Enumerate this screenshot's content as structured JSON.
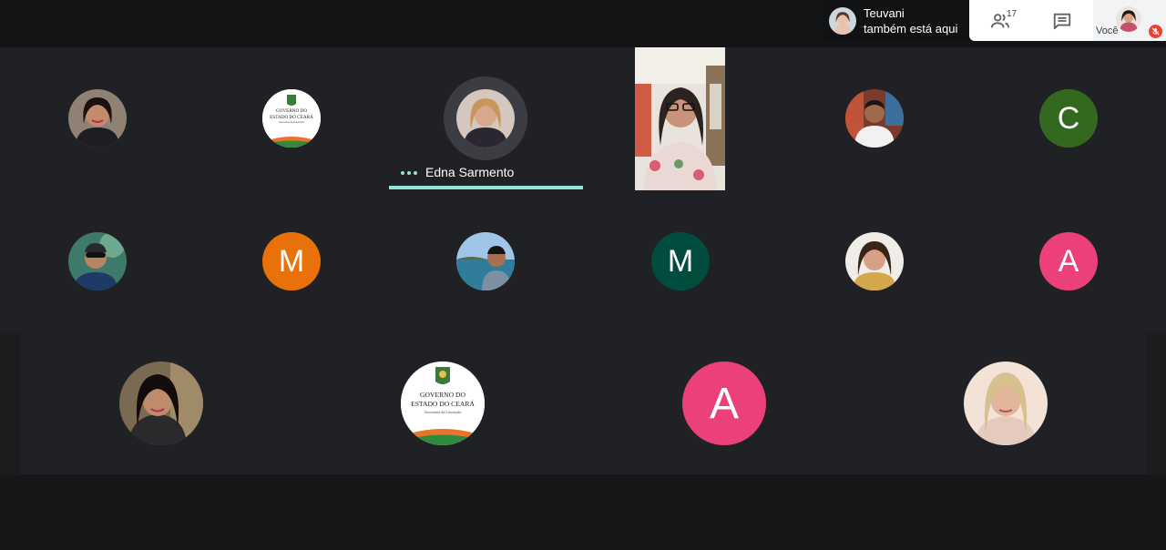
{
  "meeting": {
    "active_speaker": {
      "name": "Edna Sarmento"
    },
    "join_notice": {
      "name": "Teuvani",
      "message": "também está aqui"
    },
    "controls": {
      "participants_count": "17",
      "self_label": "Você",
      "people_icon": "people-icon",
      "chat_icon": "chat-icon",
      "mic_icon": "mic-off-icon"
    },
    "tiles": {
      "c_letter": "C",
      "m1_letter": "M",
      "m2_letter": "M",
      "a1_letter": "A",
      "a2_letter": "A"
    },
    "colors": {
      "speaking_accent": "#8ee6d6",
      "avatar_green": "#33691e",
      "avatar_orange": "#e8710a",
      "avatar_teal": "#004d40",
      "avatar_pink": "#ec407a",
      "mic_off_red": "#ea4335"
    },
    "logo": {
      "line1": "GOVERNO DO",
      "line2": "ESTADO DO CEARÁ",
      "line3": "Secretaria da Educação"
    }
  }
}
